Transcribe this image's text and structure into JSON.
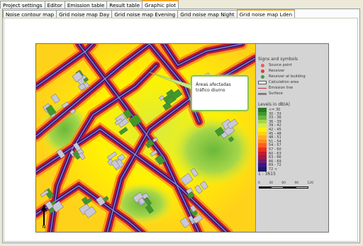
{
  "tabs": {
    "main": [
      {
        "label": "Project settings"
      },
      {
        "label": "Editor"
      },
      {
        "label": "Emission table"
      },
      {
        "label": "Result table"
      },
      {
        "label": "Graphic plot"
      }
    ],
    "active_main": "Graphic plot",
    "sub": [
      {
        "label": "Noise contour map"
      },
      {
        "label": "Grid noise map Day"
      },
      {
        "label": "Grid noise map Evening"
      },
      {
        "label": "Grid noise map Night"
      },
      {
        "label": "Grid noise map Lden"
      }
    ],
    "active_sub": "Grid noise map Lden"
  },
  "callout": {
    "line1": "Áreas afectadas",
    "line2": "tráfico diurno"
  },
  "legend": {
    "signs_title": "Signs and symbols",
    "symbols": [
      {
        "label": "Source point",
        "icon": "source-point-icon",
        "color": "#e06060"
      },
      {
        "label": "Receiver",
        "icon": "receiver-icon",
        "color": "#d04040"
      },
      {
        "label": "Receiver at building",
        "icon": "receiver-building-icon",
        "color": "#40a040"
      },
      {
        "label": "Calculation area",
        "icon": "calc-area-icon",
        "color": "#ffffff"
      },
      {
        "label": "Emission line",
        "icon": "emission-line-icon",
        "color": "#c03030"
      },
      {
        "label": "Surface",
        "icon": "surface-icon",
        "color": "#808080"
      }
    ],
    "levels_title": "Levels in dB(A)",
    "levels": [
      {
        "label": "<= 30",
        "color": "#2a7a1e"
      },
      {
        "label": "30 - 33",
        "color": "#3f9a2a"
      },
      {
        "label": "33 - 36",
        "color": "#6ab83a"
      },
      {
        "label": "36 - 39",
        "color": "#a6d64a"
      },
      {
        "label": "39 - 42",
        "color": "#d8ec3c"
      },
      {
        "label": "42 - 45",
        "color": "#fff200"
      },
      {
        "label": "45 - 48",
        "color": "#ffd21a"
      },
      {
        "label": "48 - 51",
        "color": "#ffae1c"
      },
      {
        "label": "51 - 54",
        "color": "#ff8a1e"
      },
      {
        "label": "54 - 57",
        "color": "#ff5f1f"
      },
      {
        "label": "57 - 60",
        "color": "#e8321e"
      },
      {
        "label": "60 - 63",
        "color": "#c41d2a"
      },
      {
        "label": "63 - 66",
        "color": "#9c1a4a"
      },
      {
        "label": "66 - 69",
        "color": "#6e1a6e"
      },
      {
        "label": "69 - 72",
        "color": "#3a1880"
      },
      {
        "label": "72 <",
        "color": "#1b1a6a"
      }
    ],
    "scale": "1 : 3615",
    "scale_ticks": [
      "0",
      "30",
      "60",
      "90",
      "120"
    ]
  },
  "colors": {
    "road_core": "#3a1880",
    "road_mid": "#c41d2a",
    "road_edge": "#ff8a1e",
    "building": "#c8c8d8",
    "background_low": "#ffd21a"
  }
}
